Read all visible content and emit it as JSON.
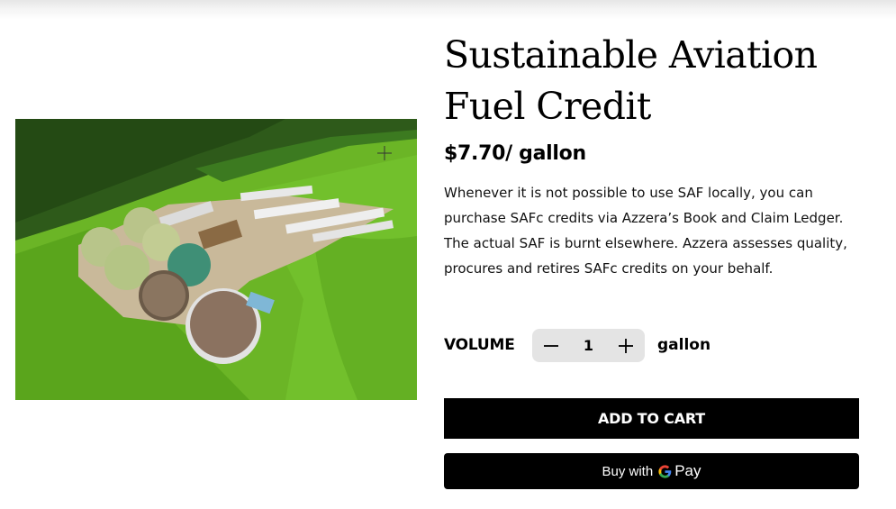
{
  "product": {
    "title_line1": "Sustainable Aviation",
    "title_line2": "Fuel Credit",
    "price": "$7.70/ gallon",
    "description": "Whenever it is not possible to use SAF locally, you can purchase SAFc credits via Azzera’s Book and Claim Ledger. The actual SAF is burnt elsewhere. Azzera assesses quality, procures and retires SAFc credits on your behalf.",
    "image_icon": "aerial-biogas-plant-photo"
  },
  "volume": {
    "label": "VOLUME",
    "quantity": "1",
    "unit": "gallon",
    "decrement_icon": "minus-icon",
    "increment_icon": "plus-icon"
  },
  "actions": {
    "add_to_cart_label": "ADD TO CART",
    "gpay_prefix": "Buy with",
    "gpay_brand": "Pay",
    "gpay_icon": "google-g-icon"
  },
  "colors": {
    "button_bg": "#000000",
    "stepper_bg": "#e4e4e4",
    "text": "#000000"
  }
}
